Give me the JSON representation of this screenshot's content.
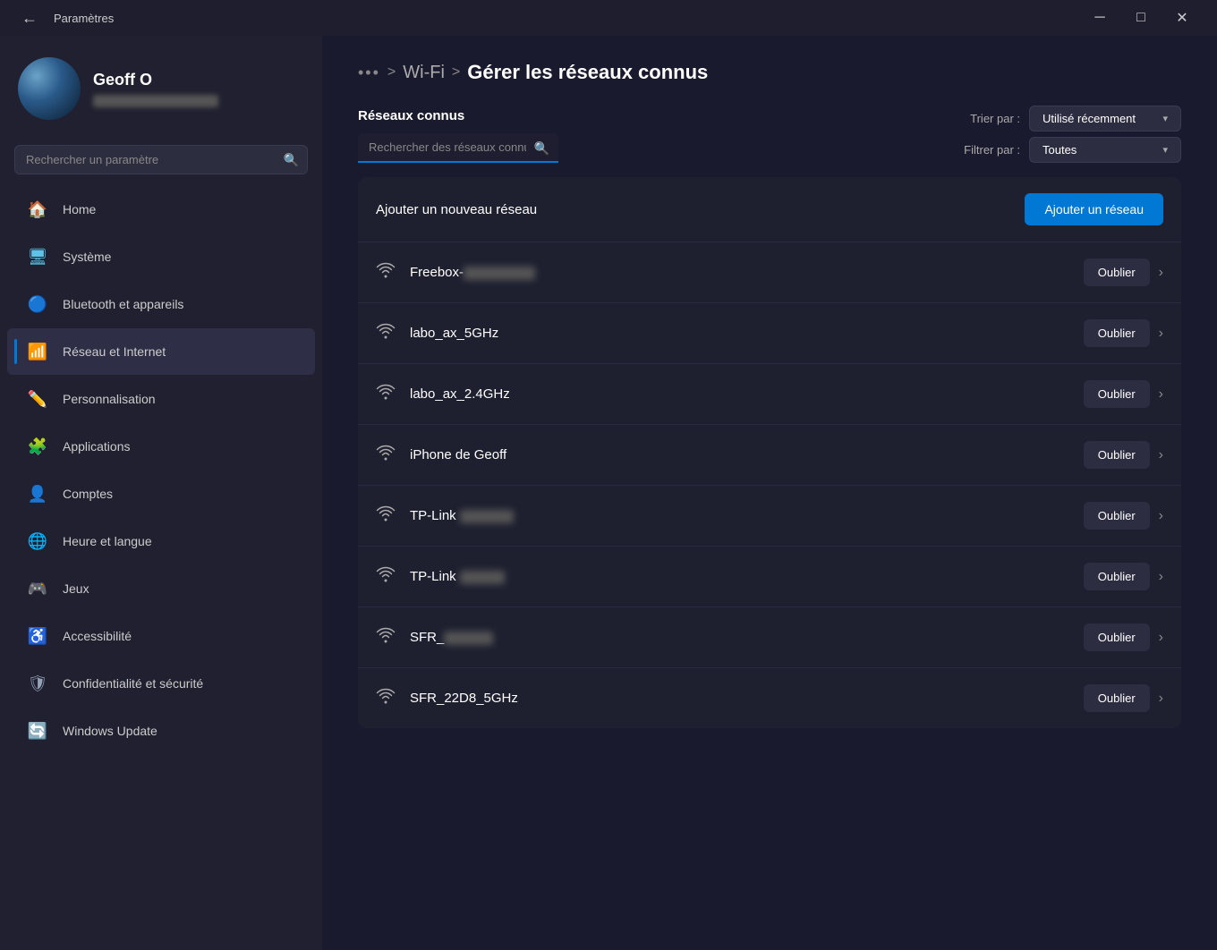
{
  "titlebar": {
    "title": "Paramètres",
    "minimize_label": "─",
    "maximize_label": "□",
    "close_label": "✕"
  },
  "sidebar": {
    "search_placeholder": "Rechercher un paramètre",
    "user": {
      "name": "Geoff O"
    },
    "nav_items": [
      {
        "id": "home",
        "label": "Home",
        "icon": "🏠",
        "icon_class": "icon-home",
        "active": false
      },
      {
        "id": "systeme",
        "label": "Système",
        "icon": "🖥",
        "icon_class": "icon-system",
        "active": false
      },
      {
        "id": "bluetooth",
        "label": "Bluetooth et appareils",
        "icon": "🔵",
        "icon_class": "icon-bluetooth",
        "active": false
      },
      {
        "id": "reseau",
        "label": "Réseau et Internet",
        "icon": "📶",
        "icon_class": "icon-network",
        "active": true
      },
      {
        "id": "personnalisation",
        "label": "Personnalisation",
        "icon": "✏️",
        "icon_class": "icon-perso",
        "active": false
      },
      {
        "id": "applications",
        "label": "Applications",
        "icon": "🧩",
        "icon_class": "icon-apps",
        "active": false
      },
      {
        "id": "comptes",
        "label": "Comptes",
        "icon": "👤",
        "icon_class": "icon-comptes",
        "active": false
      },
      {
        "id": "heure",
        "label": "Heure et langue",
        "icon": "🌐",
        "icon_class": "icon-heure",
        "active": false
      },
      {
        "id": "jeux",
        "label": "Jeux",
        "icon": "🎮",
        "icon_class": "icon-jeux",
        "active": false
      },
      {
        "id": "accessibilite",
        "label": "Accessibilité",
        "icon": "♿",
        "icon_class": "icon-access",
        "active": false
      },
      {
        "id": "confidentialite",
        "label": "Confidentialité et sécurité",
        "icon": "🛡",
        "icon_class": "icon-confidential",
        "active": false
      },
      {
        "id": "update",
        "label": "Windows Update",
        "icon": "🔄",
        "icon_class": "icon-update",
        "active": false
      }
    ]
  },
  "breadcrumb": {
    "dots": "•••",
    "separator1": ">",
    "wifi": "Wi-Fi",
    "separator2": ">",
    "current": "Gérer les réseaux connus"
  },
  "content": {
    "section_title": "Réseaux connus",
    "search_placeholder": "Rechercher des réseaux connus",
    "sort_label": "Trier par :",
    "sort_value": "Utilisé récemment",
    "filter_label": "Filtrer par :",
    "filter_value": "Toutes",
    "add_network_text": "Ajouter un nouveau réseau",
    "add_network_btn": "Ajouter un réseau",
    "forget_btn": "Oublier",
    "networks": [
      {
        "name": "Freebox-",
        "blurred_suffix": true,
        "blur_width": 80
      },
      {
        "name": "labo_ax_5GHz",
        "blurred_suffix": false
      },
      {
        "name": "labo_ax_2.4GHz",
        "blurred_suffix": false
      },
      {
        "name": "iPhone de Geoff",
        "blurred_suffix": false
      },
      {
        "name": "TP-Link ",
        "blurred_suffix": true,
        "blur_width": 60
      },
      {
        "name": "TP-Link ",
        "blurred_suffix": true,
        "blur_width": 50
      },
      {
        "name": "SFR_",
        "blurred_suffix": true,
        "blur_width": 55
      },
      {
        "name": "SFR_22D8_5GHz",
        "blurred_suffix": false,
        "partial": true
      }
    ]
  }
}
